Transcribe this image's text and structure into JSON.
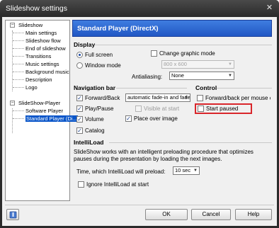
{
  "window": {
    "title": "Slideshow settings",
    "close_glyph": "✕"
  },
  "tree": {
    "items": [
      {
        "label": "Slideshow",
        "expander": "−"
      },
      {
        "label": "Main settings"
      },
      {
        "label": "Slideshow flow"
      },
      {
        "label": "End of slideshow"
      },
      {
        "label": "Transitions"
      },
      {
        "label": "Music settings"
      },
      {
        "label": "Background music"
      },
      {
        "label": "Description"
      },
      {
        "label": "Logo"
      },
      {
        "label": "SlideShow-Player",
        "expander": "−"
      },
      {
        "label": "Software Player"
      },
      {
        "label": "Standard Player (Di..."
      }
    ]
  },
  "header": {
    "title": "Standard Player (DirectX)"
  },
  "display": {
    "title": "Display",
    "full_screen": "Full screen",
    "window_mode": "Window mode",
    "change_graphic_mode": "Change graphic mode",
    "resolution_value": "800 x 600",
    "antialiasing_label": "Antialiasing:",
    "antialiasing_value": "None"
  },
  "navigation": {
    "title": "Navigation bar",
    "forward_back": "Forward/Back",
    "forward_back_mode": "automatic fade-in and fade",
    "play_pause": "Play/Pause",
    "visible_at_start": "Visible at start",
    "volume": "Volume",
    "place_over_image": "Place over image",
    "catalog": "Catalog"
  },
  "control": {
    "title": "Control",
    "forward_back_mouse": "Forward/back per mouse click",
    "start_paused": "Start paused"
  },
  "intelliload": {
    "title": "IntelliLoad",
    "description": "SlideShow works with an intelligent preloading procedure that optimizes pauses during the presentation by loading the next images.",
    "preload_label": "Time, which IntelliLoad will preload:",
    "preload_value": "10 sec",
    "ignore_label": "Ignore IntelliLoad at start"
  },
  "buttons": {
    "ok": "OK",
    "cancel": "Cancel",
    "help": "Help"
  },
  "colors": {
    "header_bg": "#2a62cc",
    "highlight": "#d9262b",
    "selection": "#0a56c9"
  }
}
